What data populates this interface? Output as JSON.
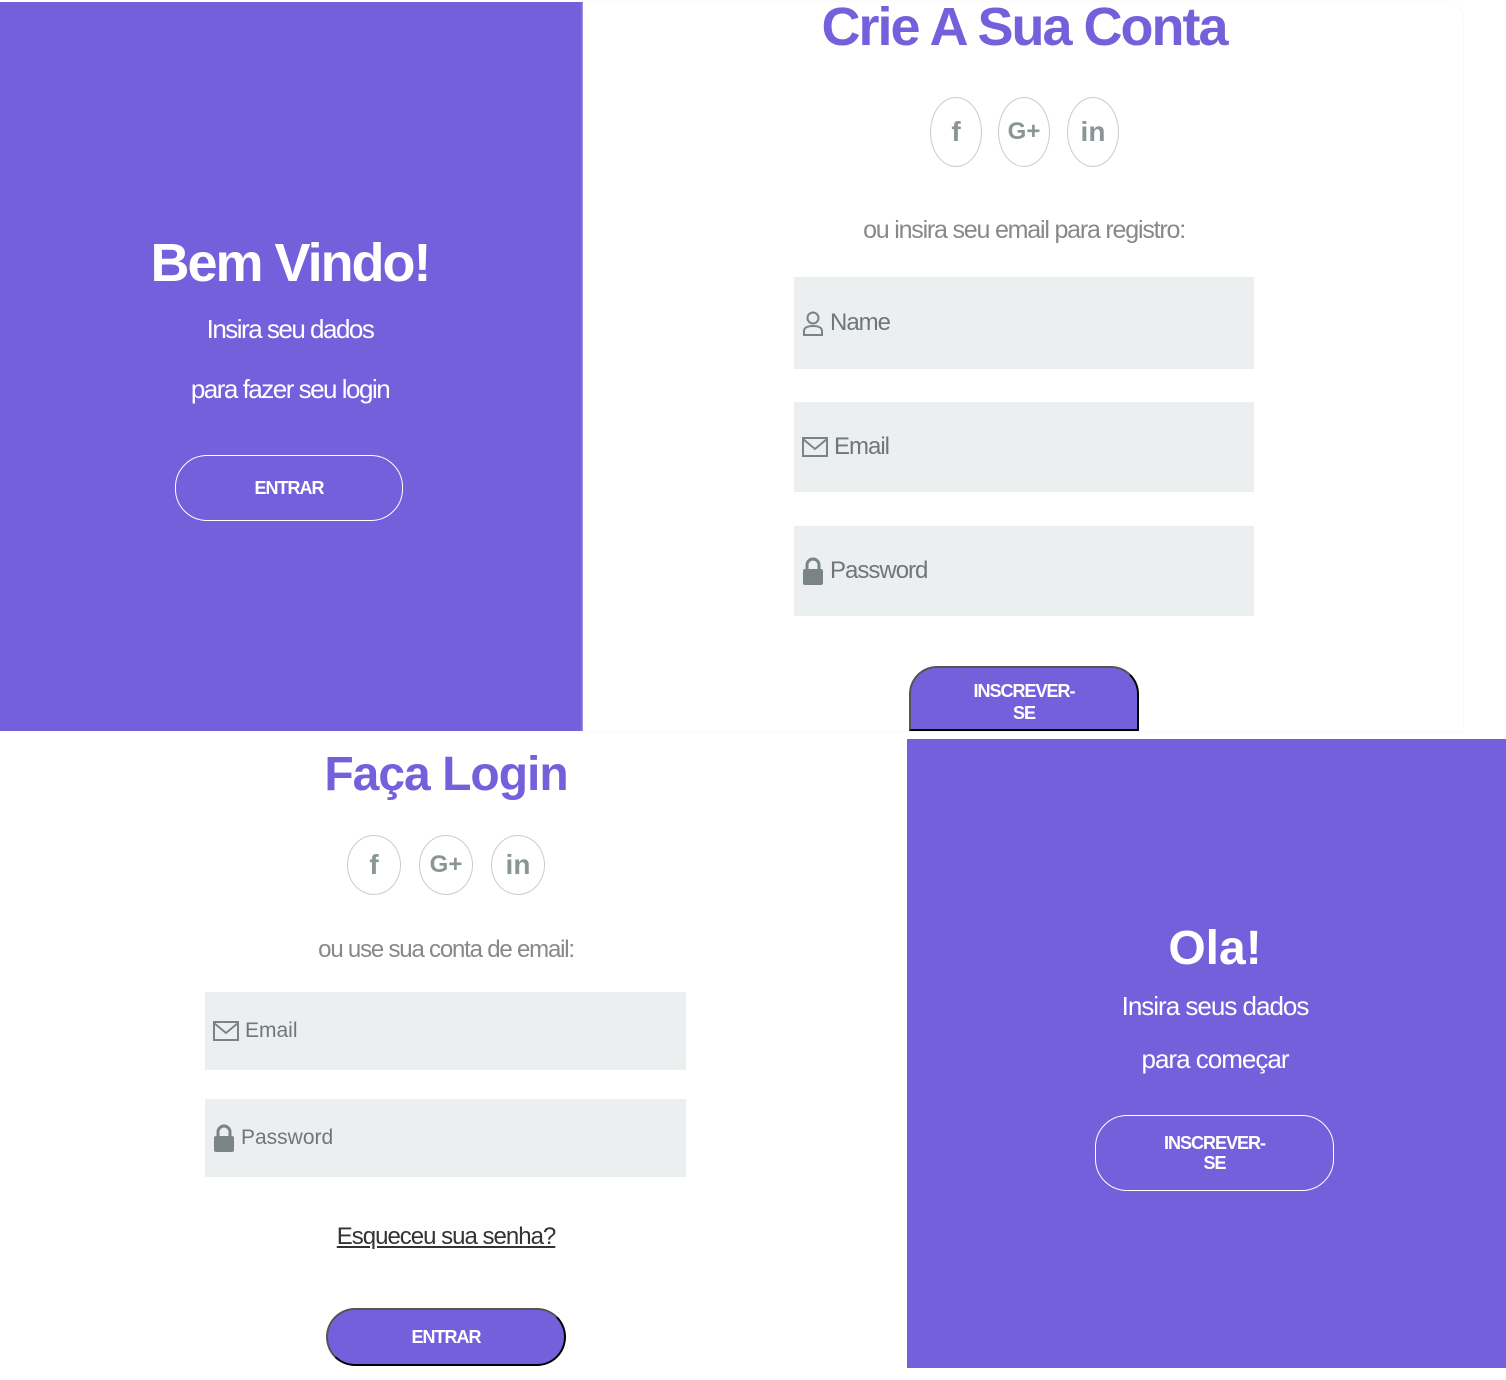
{
  "welcome_panel": {
    "title": "Bem Vindo!",
    "line1": "Insira seu dados",
    "line2": "para fazer seu login",
    "button": "ENTRAR"
  },
  "signup_form": {
    "title": "Crie A Sua Conta",
    "socials": [
      "f",
      "G+",
      "in"
    ],
    "hint": "ou insira seu email para registro:",
    "name_placeholder": "Name",
    "email_placeholder": "Email",
    "password_placeholder": "Password",
    "button_line1": "INSCREVER-",
    "button_line2": "SE"
  },
  "login_form": {
    "title": "Faça Login",
    "socials": [
      "f",
      "G+",
      "in"
    ],
    "hint": "ou use sua conta de email:",
    "email_placeholder": "Email",
    "password_placeholder": "Password",
    "forgot_link": "Esqueceu sua senha?",
    "button": "ENTRAR"
  },
  "hello_panel": {
    "title": "Ola!",
    "line1": "Insira seus dados",
    "line2": "para começar",
    "button_line1": "INSCREVER-",
    "button_line2": "SE"
  },
  "colors": {
    "accent": "#7560dc",
    "input_bg": "#ecefef"
  }
}
